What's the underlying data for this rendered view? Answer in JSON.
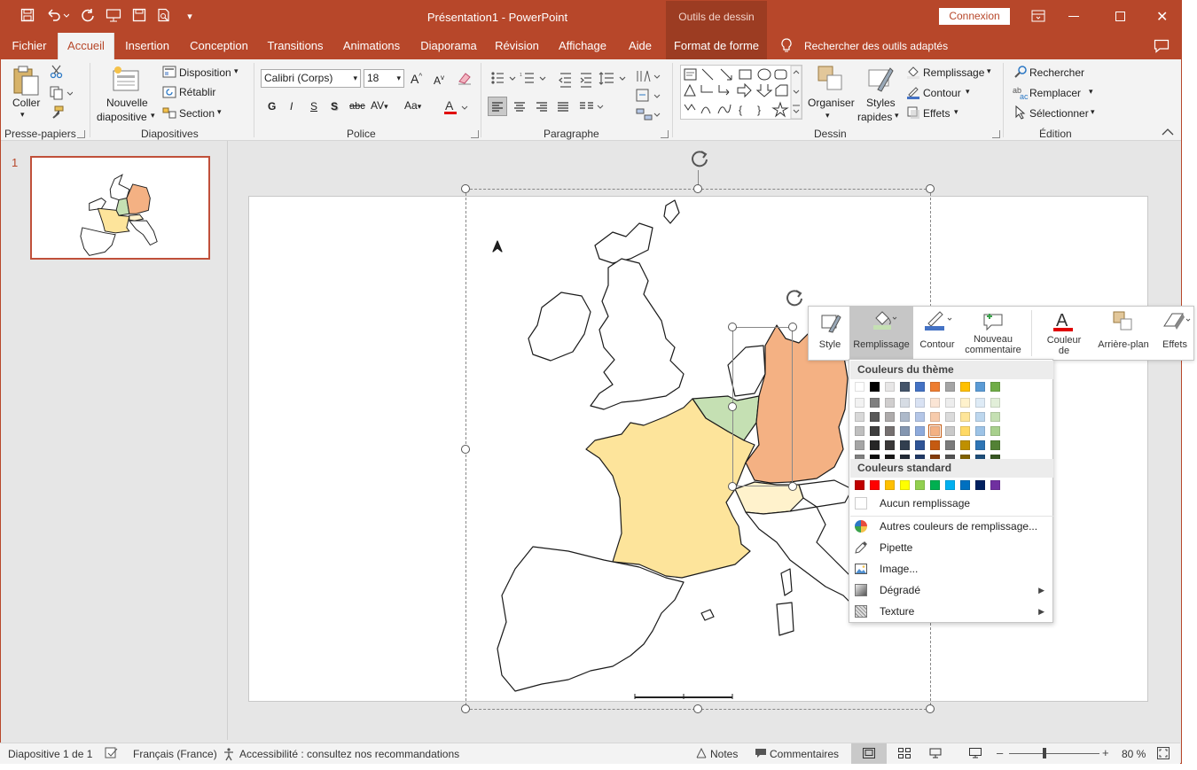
{
  "window": {
    "title": "Présentation1  -  PowerPoint",
    "contextual_group": "Outils de dessin",
    "login_button": "Connexion"
  },
  "tabs": [
    {
      "label": "Fichier",
      "active": false
    },
    {
      "label": "Accueil",
      "active": true
    },
    {
      "label": "Insertion",
      "active": false
    },
    {
      "label": "Conception",
      "active": false
    },
    {
      "label": "Transitions",
      "active": false
    },
    {
      "label": "Animations",
      "active": false
    },
    {
      "label": "Diaporama",
      "active": false
    },
    {
      "label": "Révision",
      "active": false
    },
    {
      "label": "Affichage",
      "active": false
    },
    {
      "label": "Aide",
      "active": false
    },
    {
      "label": "Format de forme",
      "active": false
    }
  ],
  "tell_me": "Rechercher des outils adaptés",
  "ribbon": {
    "clipboard": {
      "label": "Presse-papiers",
      "paste": "Coller"
    },
    "slides": {
      "label": "Diapositives",
      "new_slide_1": "Nouvelle",
      "new_slide_2": "diapositive",
      "layout": "Disposition",
      "reset": "Rétablir",
      "section": "Section"
    },
    "font": {
      "label": "Police",
      "font_name": "Calibri (Corps)",
      "font_size": "18",
      "bold": "G",
      "italic": "I",
      "underline": "S",
      "shadow": "S",
      "strike": "abc"
    },
    "paragraph": {
      "label": "Paragraphe"
    },
    "drawing": {
      "label": "Dessin",
      "arrange": "Organiser",
      "quick_styles_1": "Styles",
      "quick_styles_2": "rapides",
      "fill": "Remplissage",
      "outline": "Contour",
      "effects": "Effets"
    },
    "editing": {
      "label": "Édition",
      "find": "Rechercher",
      "replace": "Remplacer",
      "select": "Sélectionner"
    }
  },
  "thumbnail": {
    "number": "1"
  },
  "mini_toolbar": {
    "style": "Style",
    "fill": "Remplissage",
    "outline": "Contour",
    "new_comment_1": "Nouveau",
    "new_comment_2": "commentaire",
    "font_color_1": "Couleur",
    "font_color_2": "de",
    "background": "Arrière-plan",
    "effects": "Effets"
  },
  "fill_menu": {
    "theme_colors_header": "Couleurs du thème",
    "standard_colors_header": "Couleurs standard",
    "theme_colors": [
      "#ffffff",
      "#000000",
      "#e7e6e6",
      "#44546a",
      "#4472c4",
      "#ed7d31",
      "#a5a5a5",
      "#ffc000",
      "#5b9bd5",
      "#70ad47"
    ],
    "theme_tints": [
      [
        "#f2f2f2",
        "#7f7f7f",
        "#d0cece",
        "#d6dce4",
        "#d9e2f3",
        "#fbe5d5",
        "#ededed",
        "#fff2cc",
        "#deebf6",
        "#e2efd9"
      ],
      [
        "#d8d8d8",
        "#595959",
        "#aeabab",
        "#adb9ca",
        "#b4c6e7",
        "#f7cbac",
        "#dbdbdb",
        "#fee599",
        "#bdd7ee",
        "#c5e0b3"
      ],
      [
        "#bfbfbf",
        "#3f3f3f",
        "#757070",
        "#8496b0",
        "#8eaadb",
        "#f4b183",
        "#c9c9c9",
        "#ffd965",
        "#9dc3e6",
        "#a8d08d"
      ],
      [
        "#a5a5a5",
        "#262626",
        "#3a3838",
        "#323f4f",
        "#2f5496",
        "#c55a11",
        "#7b7b7b",
        "#bf9000",
        "#2e75b5",
        "#538135"
      ],
      [
        "#7f7f7f",
        "#0c0c0c",
        "#171616",
        "#222a35",
        "#1f3864",
        "#833c0b",
        "#525252",
        "#7f6000",
        "#1e4e79",
        "#375623"
      ]
    ],
    "standard_colors": [
      "#c00000",
      "#ff0000",
      "#ffc000",
      "#ffff00",
      "#92d050",
      "#00b050",
      "#00b0f0",
      "#0070c0",
      "#002060",
      "#7030a0"
    ],
    "no_fill": "Aucun remplissage",
    "more_colors": "Autres couleurs de remplissage...",
    "eyedropper": "Pipette",
    "picture": "Image...",
    "gradient": "Dégradé",
    "texture": "Texture"
  },
  "map_colors": {
    "france": "#fde49b",
    "germany": "#f4b183",
    "belgium": "#c5e0b3",
    "switzerland": "#fff2cc"
  },
  "status": {
    "slide_counter": "Diapositive 1 de 1",
    "language": "Français (France)",
    "accessibility": "Accessibilité : consultez nos recommandations",
    "notes": "Notes",
    "comments": "Commentaires",
    "zoom": "80 %"
  }
}
